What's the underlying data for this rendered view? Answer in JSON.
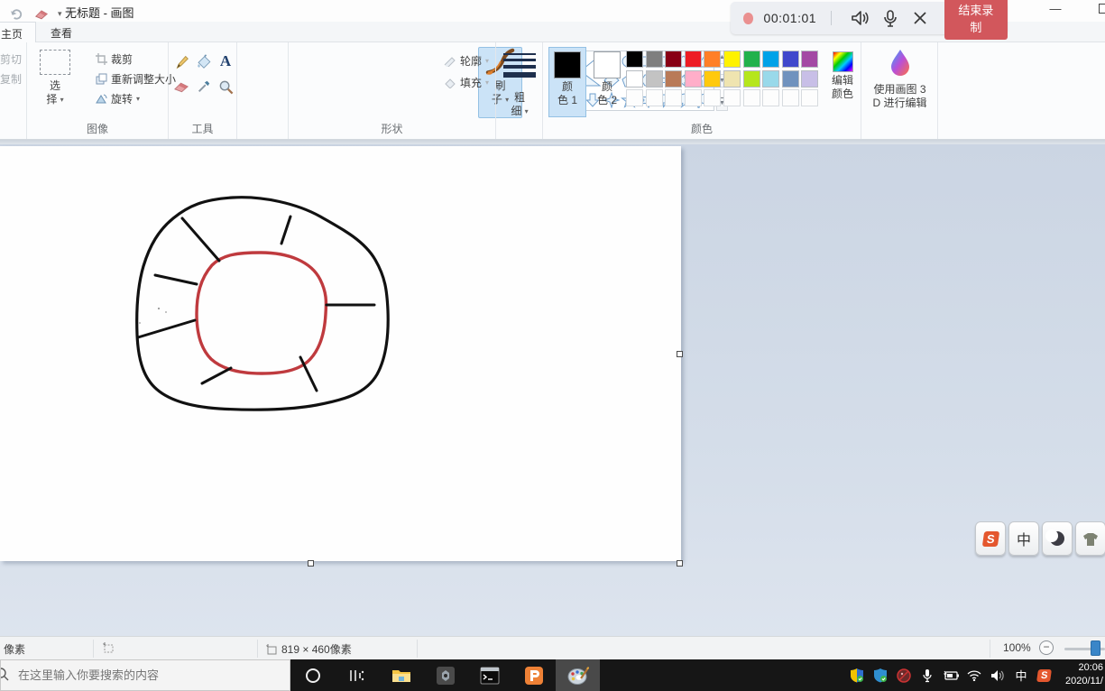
{
  "titlebar": {
    "title": "无标题 - 画图",
    "minimize_glyph": "—"
  },
  "recording": {
    "time": "00:01:01",
    "stop_label": "结束录制",
    "accent": "#d2575c"
  },
  "tabs": [
    {
      "label": "主页",
      "active": true
    },
    {
      "label": "查看",
      "active": false
    }
  ],
  "ribbon": {
    "clipboard": {
      "cut": "剪切",
      "copy": "复制"
    },
    "image": {
      "select_l1": "选",
      "select_l2": "择",
      "crop": "裁剪",
      "resize": "重新调整大小",
      "rotate": "旋转",
      "label": "图像"
    },
    "tools": {
      "label": "工具",
      "icons": [
        "pencil",
        "fill",
        "text",
        "eraser",
        "color-picker",
        "magnifier"
      ]
    },
    "brush": {
      "l1": "刷",
      "l2": "子"
    },
    "shapes": {
      "label": "形状",
      "outline": "轮廓",
      "fill": "填充",
      "items": [
        "line",
        "curve",
        "ellipse",
        "rectangle",
        "rounded-rectangle",
        "polygon",
        "triangle",
        "right-triangle",
        "diamond",
        "pentagon",
        "hexagon",
        "arrow-right",
        "arrow-left",
        "arrow-up",
        "arrow-down",
        "star-4",
        "star-5",
        "star-6",
        "callout-rounded",
        "callout-oval",
        "callout-cloud"
      ]
    },
    "size": {
      "l1": "粗",
      "l2": "细"
    },
    "colors": {
      "label": "颜色",
      "color1_l1": "颜",
      "color1_l2": "色 1",
      "color2_l1": "颜",
      "color2_l2": "色 2",
      "edit_l1": "编辑",
      "edit_l2": "颜色",
      "color1": "#000000",
      "color2": "#ffffff",
      "palette_row1": [
        "#000000",
        "#7f7f7f",
        "#880015",
        "#ed1c24",
        "#ff7f27",
        "#fff200",
        "#22b14c",
        "#00a2e8",
        "#3f48cc",
        "#a349a4"
      ],
      "palette_row2": [
        "#ffffff",
        "#c3c3c3",
        "#b97a57",
        "#ffaec9",
        "#ffc90e",
        "#efe4b0",
        "#b5e61d",
        "#99d9ea",
        "#7092be",
        "#c8bfe7"
      ],
      "palette_row3": [
        "",
        "",
        "",
        "",
        "",
        "",
        "",
        "",
        "",
        ""
      ]
    },
    "paint3d": {
      "l1": "使用画图 3",
      "l2": "D 进行编辑"
    }
  },
  "drawing_colors": {
    "outline": "#111111",
    "inner_ring": "#bf3a3e"
  },
  "statusbar": {
    "cursor_label": "像素",
    "canvas_size": "819 × 460像素",
    "zoom_level": "100%"
  },
  "taskbar": {
    "search_placeholder": "在这里输入你要搜索的内容",
    "app_icons": [
      "cortana",
      "task-view",
      "file-explorer",
      "recorder-app",
      "command-prompt",
      "potplayer",
      "paint"
    ],
    "tray_icons": [
      "defender-shield",
      "antivirus-shield",
      "security-app",
      "microphone",
      "battery",
      "wifi",
      "volume",
      "ime-zh",
      "sogou"
    ],
    "ime": "中",
    "time": "20:06",
    "date": "2020/11/"
  },
  "ime_toolbar": {
    "mode_label": "中",
    "icons": [
      "sogou-logo",
      "chinese-mode",
      "moon-fullwidth",
      "skin"
    ]
  }
}
